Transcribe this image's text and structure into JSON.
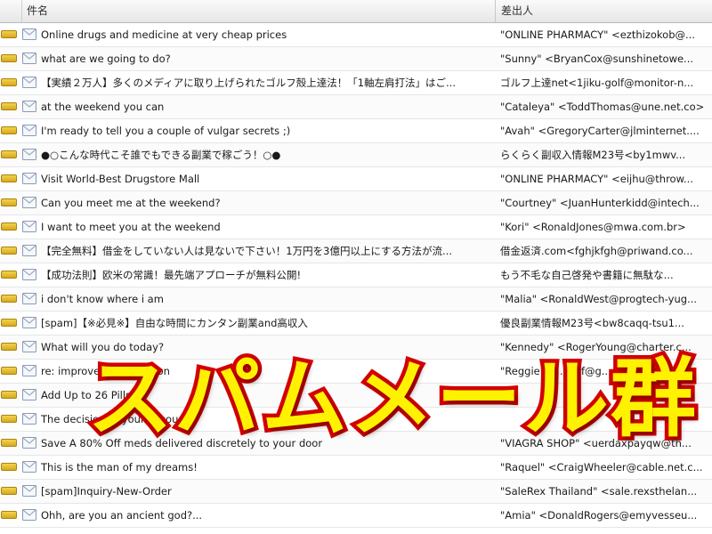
{
  "columns": {
    "subject": "件名",
    "sender": "差出人"
  },
  "colors": {
    "overlay_fill": "#fff200",
    "overlay_stroke": "#d40000",
    "flag": "#e6b823"
  },
  "icons": {
    "flag": "flag-icon",
    "mail": "envelope-icon"
  },
  "messages": [
    {
      "subject": "Online drugs and medicine at very cheap prices",
      "sender": "\"ONLINE PHARMACY\" <ezthizokob@..."
    },
    {
      "subject": "what are we going to do?",
      "sender": "\"Sunny\" <BryanCox@sunshinetowe..."
    },
    {
      "subject": "【実績２万人】多くのメディアに取り上げられたゴルフ殻上達法！「1軸左肩打法」はご...",
      "sender": "ゴルフ上達net<1jiku-golf@monitor-n..."
    },
    {
      "subject": "at the weekend you can",
      "sender": "\"Cataleya\" <ToddThomas@une.net.co>"
    },
    {
      "subject": "I'm ready to tell you a couple of vulgar secrets ;)",
      "sender": "\"Avah\" <GregoryCarter@jlminternet...."
    },
    {
      "subject": "●○こんな時代こそ誰でもできる副業で稼ごう！○●",
      "sender": "らくらく副収入情報M23号<by1mwv..."
    },
    {
      "subject": "Visit World-Best Drugstore Mall",
      "sender": "\"ONLINE PHARMACY\" <eijhu@throw..."
    },
    {
      "subject": "Can you meet me at the weekend?",
      "sender": "\"Courtney\" <JuanHunterkidd@intech..."
    },
    {
      "subject": "I want to meet you at the weekend",
      "sender": "\"Kori\" <RonaldJones@mwa.com.br>"
    },
    {
      "subject": "【完全無料】借金をしていない人は見ないで下さい！1万円を3億円以上にする方法が流...",
      "sender": "借金返済.com<fghjkfgh@priwand.co..."
    },
    {
      "subject": "【成功法則】欧米の常識！最先端アプローチが無料公開!",
      "sender": "もう不毛な自己啓発や書籍に無駄な..."
    },
    {
      "subject": "i don't know where i am",
      "sender": "\"Malia\" <RonaldWest@progtech-yug..."
    },
    {
      "subject": "[spam]【※必見※】自由な時間にカンタン副業and高収入",
      "sender": "優良副業情報M23号<bw8caqq-tsu1..."
    },
    {
      "subject": "What will you do today?",
      "sender": "\"Kennedy\" <RogerYoung@charter.c..."
    },
    {
      "subject": "re: improve your position",
      "sender": "\"Reggie\" <...kaif@g..."
    },
    {
      "subject": "Add Up to 26 Pills",
      "sender": ""
    },
    {
      "subject": "The decision of your account",
      "sender": ""
    },
    {
      "subject": "Save A 80% Off meds delivered discretely to your door",
      "sender": "\"VIAGRA SHOP\" <uerdaxpayqw@th..."
    },
    {
      "subject": "This is the man of my dreams!",
      "sender": "\"Raquel\" <CraigWheeler@cable.net.c..."
    },
    {
      "subject": "[spam]Inquiry-New-Order",
      "sender": "\"SaleRex Thailand\" <sale.rexsthelan..."
    },
    {
      "subject": "Ohh, are you an ancient god?...",
      "sender": "\"Amia\" <DonaldRogers@emyvesseu..."
    }
  ],
  "overlay": {
    "text": "スパムメール群"
  }
}
